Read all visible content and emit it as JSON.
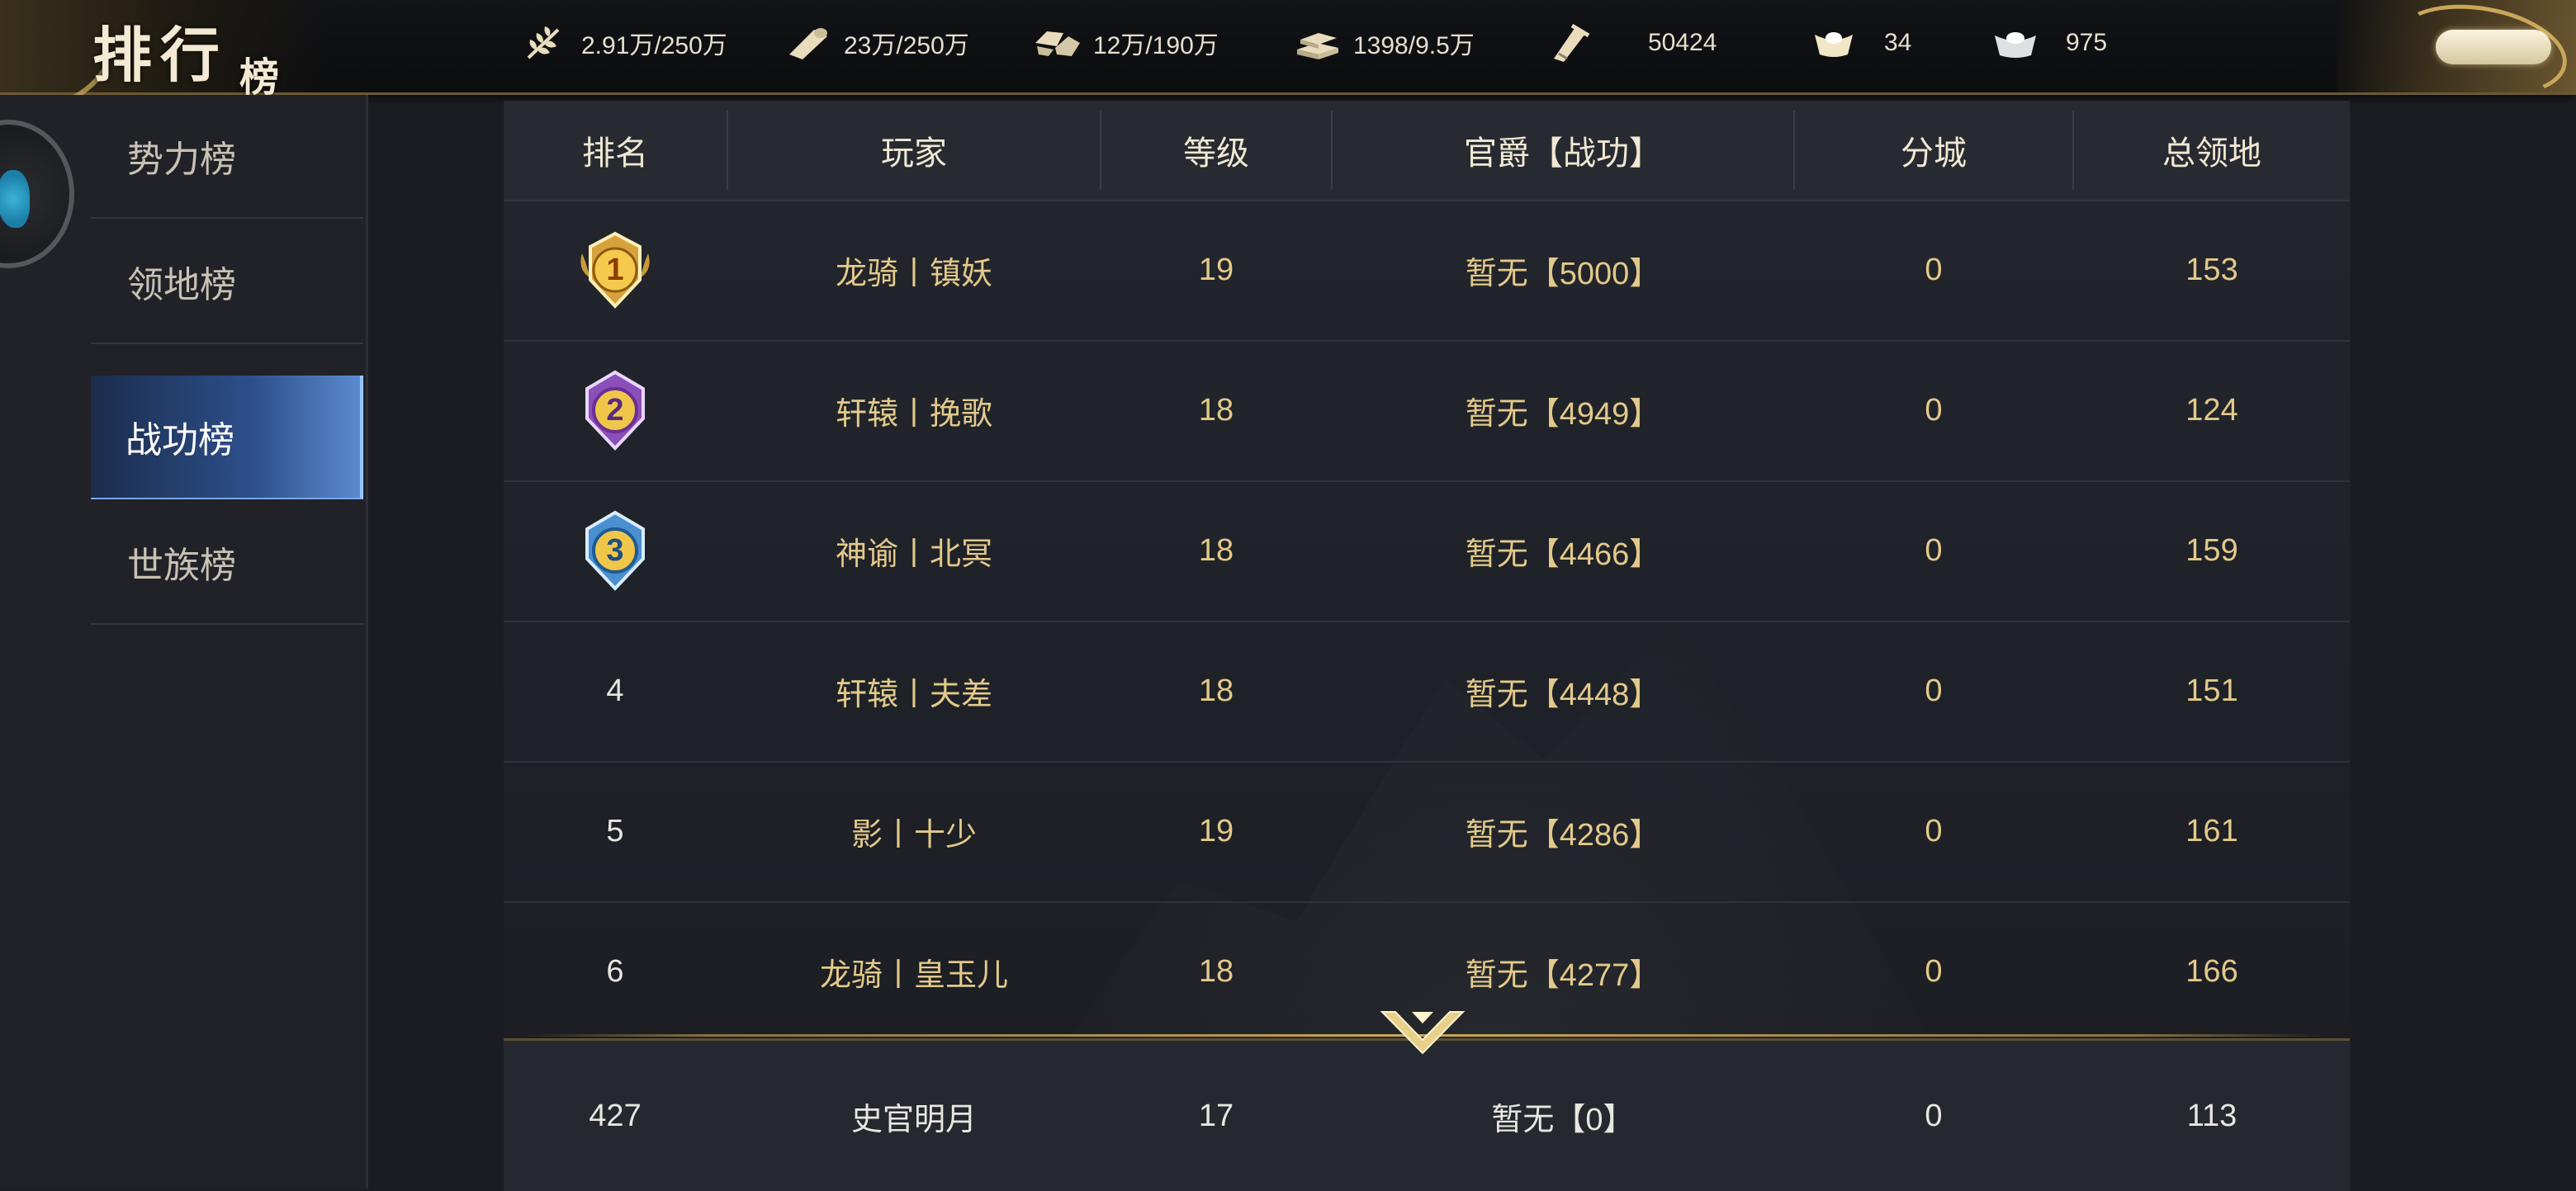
{
  "header": {
    "title": "排行",
    "title_sub": "榜"
  },
  "resources": [
    {
      "icon": "grain-icon",
      "value": "2.91万/250万"
    },
    {
      "icon": "wood-icon",
      "value": "23万/250万"
    },
    {
      "icon": "stone-icon",
      "value": "12万/190万"
    },
    {
      "icon": "iron-icon",
      "value": "1398/9.5万"
    },
    {
      "icon": "decree-icon",
      "value": "50424"
    },
    {
      "icon": "gold-ingot-icon",
      "value": "34"
    },
    {
      "icon": "silver-ingot-icon",
      "value": "975"
    }
  ],
  "nav": {
    "items": [
      {
        "label": "势力榜",
        "active": false
      },
      {
        "label": "领地榜",
        "active": false
      },
      {
        "label": "战功榜",
        "active": true
      },
      {
        "label": "世族榜",
        "active": false
      }
    ]
  },
  "table": {
    "headers": [
      "排名",
      "玩家",
      "等级",
      "官爵【战功】",
      "分城",
      "总领地"
    ],
    "rows": [
      {
        "rank": "1",
        "medal": "gold",
        "player": "龙骑丨镇妖",
        "level": "19",
        "rank_title": "暂无【5000】",
        "branch": "0",
        "territory": "153"
      },
      {
        "rank": "2",
        "medal": "purple",
        "player": "轩辕丨挽歌",
        "level": "18",
        "rank_title": "暂无【4949】",
        "branch": "0",
        "territory": "124"
      },
      {
        "rank": "3",
        "medal": "blue",
        "player": "神谕丨北冥",
        "level": "18",
        "rank_title": "暂无【4466】",
        "branch": "0",
        "territory": "159"
      },
      {
        "rank": "4",
        "medal": "",
        "player": "轩辕丨夫差",
        "level": "18",
        "rank_title": "暂无【4448】",
        "branch": "0",
        "territory": "151"
      },
      {
        "rank": "5",
        "medal": "",
        "player": "影丨十少",
        "level": "19",
        "rank_title": "暂无【4286】",
        "branch": "0",
        "territory": "161"
      },
      {
        "rank": "6",
        "medal": "",
        "player": "龙骑丨皇玉儿",
        "level": "18",
        "rank_title": "暂无【4277】",
        "branch": "0",
        "territory": "166"
      }
    ],
    "self_row": {
      "rank": "427",
      "player": "史官明月",
      "level": "17",
      "rank_title": "暂无【0】",
      "branch": "0",
      "territory": "113"
    }
  },
  "colors": {
    "gold_text": "#e3c98a",
    "nav_active": "#2d4f8a",
    "gold_trim": "#c9a75a"
  }
}
